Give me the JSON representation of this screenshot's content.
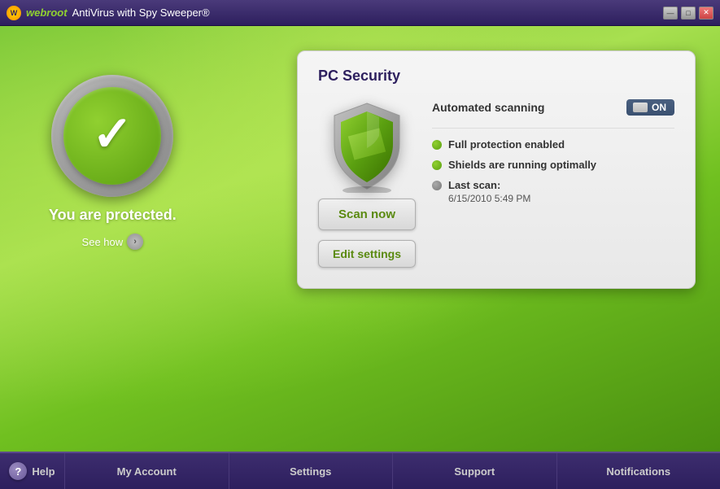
{
  "titleBar": {
    "appName": "webroot",
    "appTitle": "AntiVirus with Spy Sweeper®",
    "logoText": "W",
    "minBtn": "—",
    "maxBtn": "□",
    "closeBtn": "✕"
  },
  "mainArea": {
    "protectionStatus": "You are protected.",
    "seeHow": "See how",
    "pcSecurity": {
      "title": "PC Security",
      "automatedScanning": "Automated scanning",
      "toggleState": "ON",
      "statusItems": [
        {
          "label": "Full protection enabled",
          "type": "green"
        },
        {
          "label": "Shields are running optimally",
          "type": "green"
        },
        {
          "label": "Last scan:",
          "subtext": "6/15/2010 5:49 PM",
          "type": "gray"
        }
      ],
      "scanBtn": "Scan now",
      "editBtn": "Edit settings"
    }
  },
  "bottomNav": {
    "helpCircle": "?",
    "items": [
      {
        "label": "Help",
        "id": "help"
      },
      {
        "label": "My Account",
        "id": "my-account"
      },
      {
        "label": "Settings",
        "id": "settings"
      },
      {
        "label": "Support",
        "id": "support"
      },
      {
        "label": "Notifications",
        "id": "notifications"
      }
    ]
  }
}
